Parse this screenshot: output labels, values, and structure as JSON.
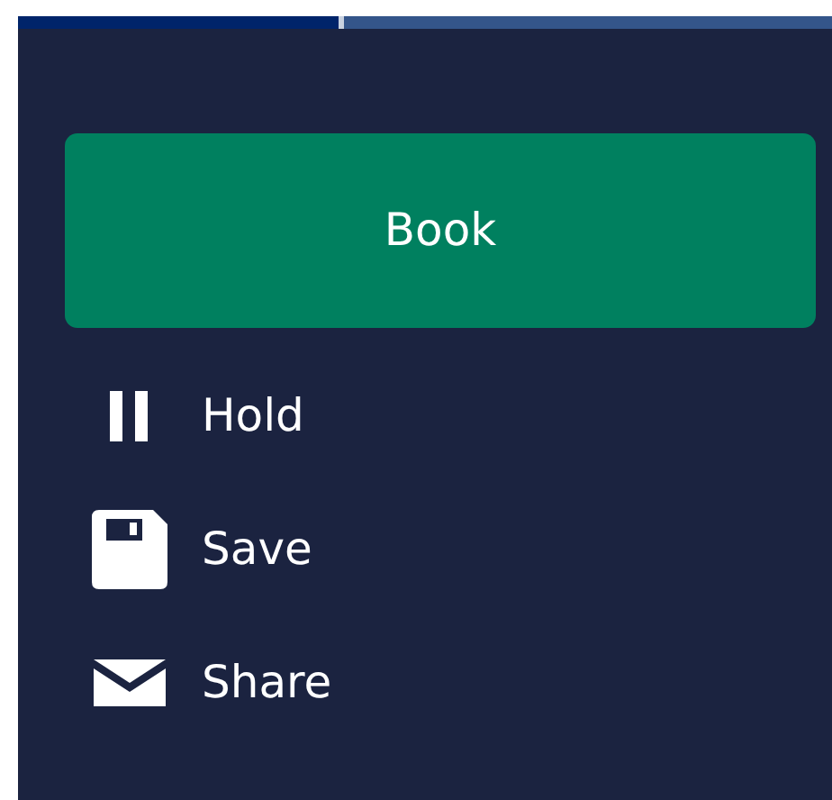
{
  "progress": {
    "level": 0.4
  },
  "primary_button": {
    "label": "Book"
  },
  "actions": [
    {
      "kind": "pause",
      "label": "Hold"
    },
    {
      "kind": "save",
      "label": "Save"
    },
    {
      "kind": "mail",
      "label": "Share"
    }
  ]
}
